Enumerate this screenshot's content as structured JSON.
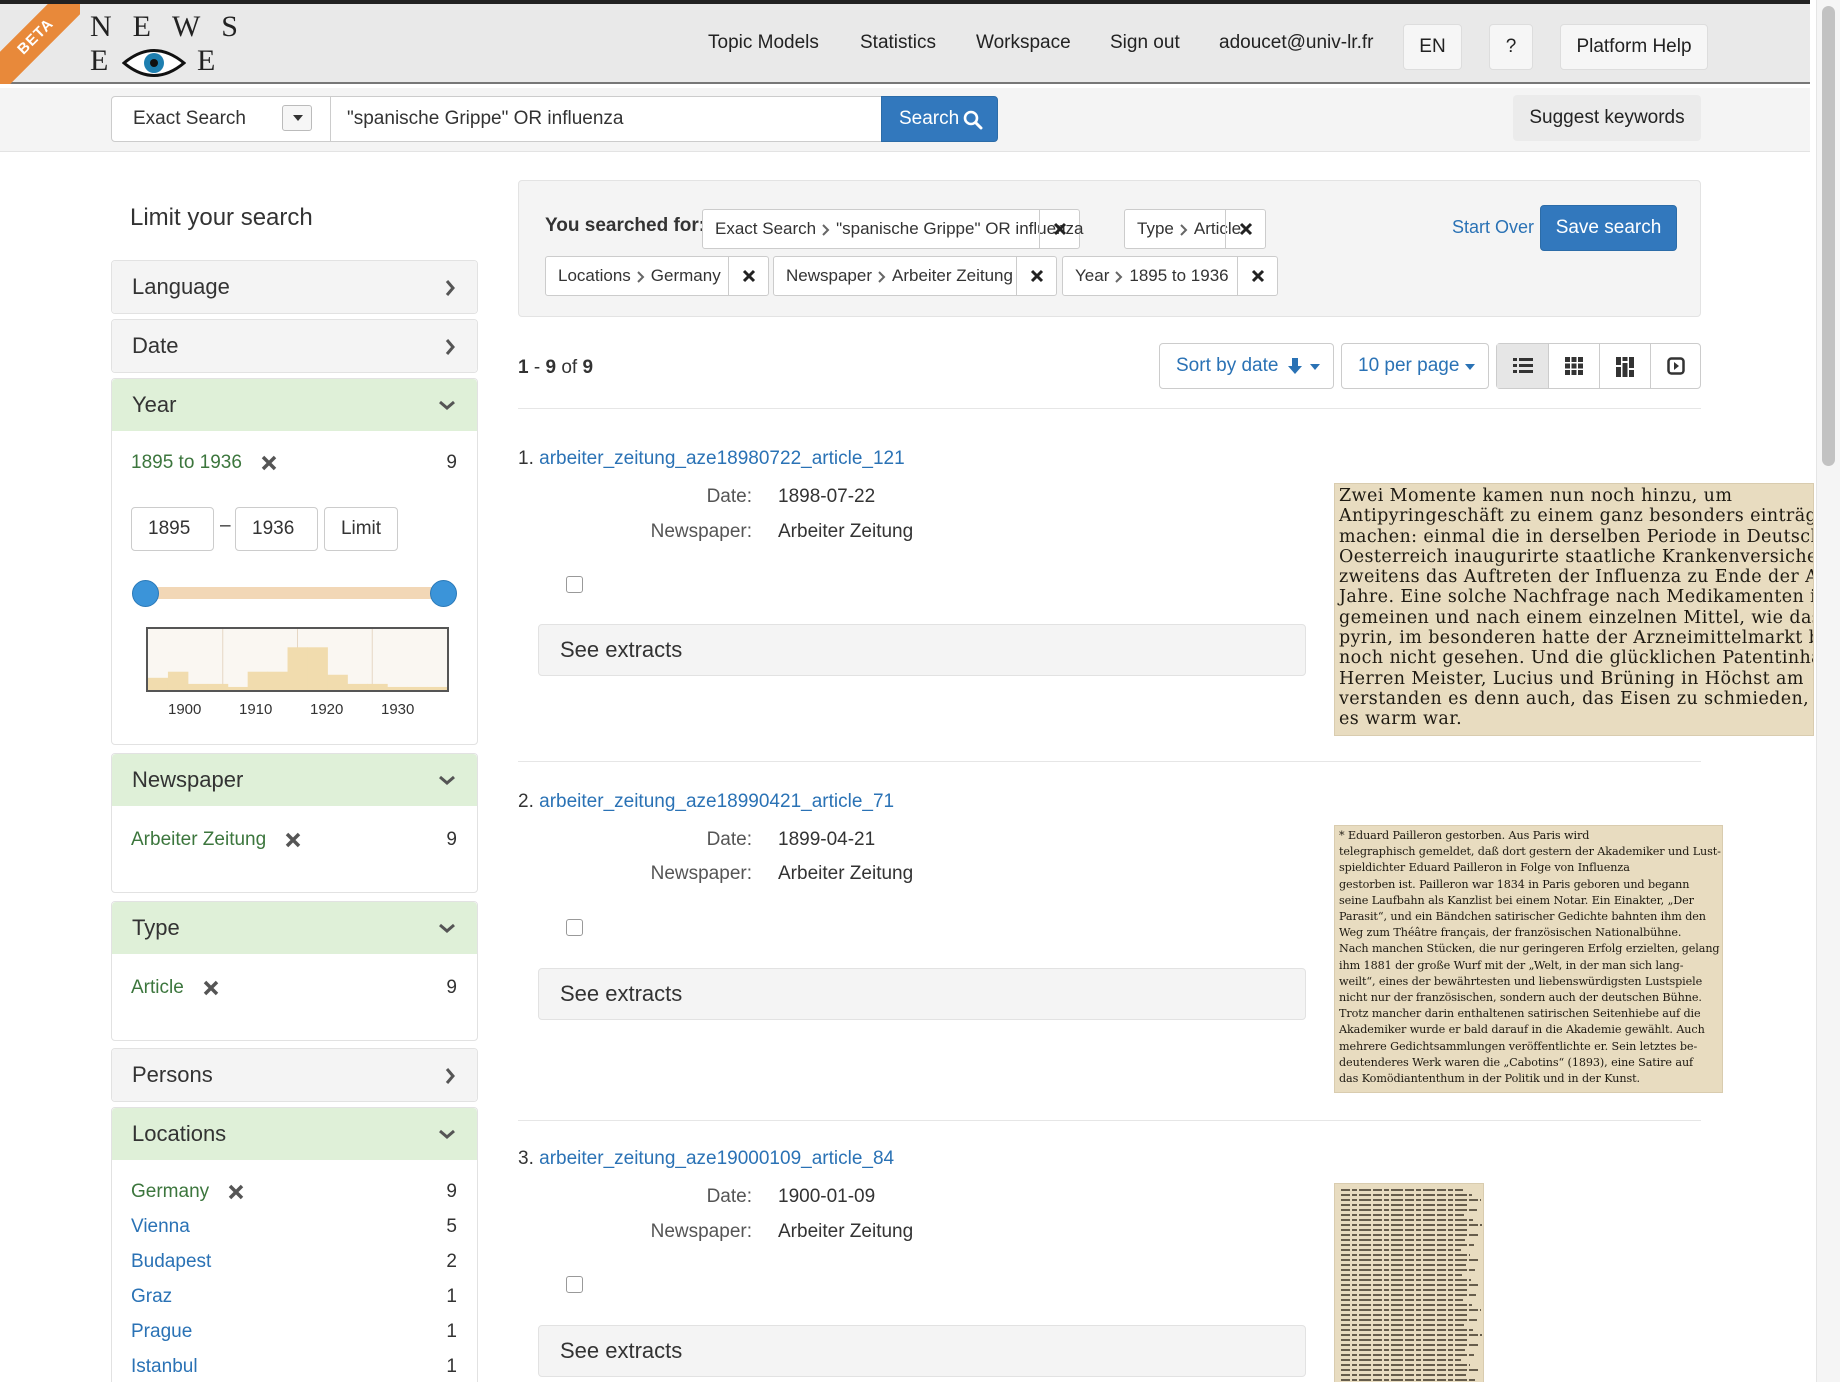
{
  "brand": {
    "beta": "BETA",
    "logo_top": "NEWS",
    "logo_left": "E",
    "logo_right": "E"
  },
  "nav": {
    "links": [
      "Topic Models",
      "Statistics",
      "Workspace",
      "Sign out",
      "adoucet@univ-lr.fr"
    ],
    "lang": "EN",
    "help_q": "?",
    "platform_help": "Platform Help"
  },
  "search": {
    "mode": "Exact Search",
    "query": "\"spanische Grippe\" OR influenza",
    "button": "Search",
    "suggest": "Suggest keywords"
  },
  "sidebar": {
    "title": "Limit your search",
    "facets": {
      "language": "Language",
      "date": "Date",
      "year": {
        "label": "Year",
        "selected": "1895 to 1936",
        "count": "9",
        "from": "1895",
        "to": "1936",
        "dash": "–",
        "limit": "Limit",
        "ticks": [
          "1900",
          "1910",
          "1920",
          "1930"
        ],
        "histogram": [
          0.2,
          0.3,
          0.1,
          0.1,
          0.05,
          0.3,
          0.3,
          0.7,
          0.7,
          0.25,
          0.1,
          0.1,
          0.05,
          0.05,
          0.05
        ]
      },
      "newspaper": {
        "label": "Newspaper",
        "value": "Arbeiter Zeitung",
        "count": "9"
      },
      "type": {
        "label": "Type",
        "value": "Article",
        "count": "9"
      },
      "persons": "Persons",
      "locations": {
        "label": "Locations",
        "items": [
          {
            "name": "Germany",
            "count": "9"
          },
          {
            "name": "Vienna",
            "count": "5"
          },
          {
            "name": "Budapest",
            "count": "2"
          },
          {
            "name": "Graz",
            "count": "1"
          },
          {
            "name": "Prague",
            "count": "1"
          },
          {
            "name": "Istanbul",
            "count": "1"
          }
        ]
      }
    }
  },
  "constraints": {
    "label": "You searched for:",
    "chips": [
      {
        "field": "Exact Search",
        "value": "\"spanische Grippe\" OR influenza"
      },
      {
        "field": "Type",
        "value": "Article"
      },
      {
        "field": "Locations",
        "value": "Germany"
      },
      {
        "field": "Newspaper",
        "value": "Arbeiter Zeitung"
      },
      {
        "field": "Year",
        "value": "1895 to 1936"
      }
    ],
    "start_over": "Start Over",
    "save": "Save search"
  },
  "results_bar": {
    "range_from": "1",
    "range_to": "9",
    "of": "of",
    "total": "9",
    "sort": "Sort by date",
    "per_page": "10 per page"
  },
  "results": [
    {
      "num": "1.",
      "title": "arbeiter_zeitung_aze18980722_article_121",
      "date_label": "Date:",
      "date": "1898-07-22",
      "paper_label": "Newspaper:",
      "paper": "Arbeiter Zeitung",
      "extracts": "See extracts",
      "scan_text": "Zwei Momente kamen nun noch hinzu, um\nAntipyringeschäft zu einem ganz besonders einträglid\nmachen: einmal die in derselben Periode in Deutschlan\nOesterreich inaugurirte staatliche Krankenversicherung,\nzweitens das Auftreten der Influenza zu Ende der Ach\nJahre. Eine solche Nachfrage nach Medikamenten i\ngemeinen und nach einem einzelnen Mittel, wie das\npyrin, im besonderen hatte der Arzneimittelmarkt bis\nnoch nicht gesehen. Und die glücklichen Patentinhaber\nHerren Meister, Lucius und Brüning in Höchst am\nverstanden es denn auch, das Eisen zu schmieden, so\nes warm war."
    },
    {
      "num": "2.",
      "title": "arbeiter_zeitung_aze18990421_article_71",
      "date_label": "Date:",
      "date": "1899-04-21",
      "paper_label": "Newspaper:",
      "paper": "Arbeiter Zeitung",
      "extracts": "See extracts",
      "scan_text": "* Eduard Pailleron gestorben. Aus Paris wird\ntelegraphisch gemeldet, daß dort gestern der Akademiker und Lust-\nspieldichter Eduard Pailleron in Folge von Influenza\ngestorben ist. Pailleron war 1834 in Paris geboren und begann\nseine Laufbahn als Kanzlist bei einem Notar. Ein Einakter, „Der\nParasit“, und ein Bändchen satirischer Gedichte bahnten ihm den\nWeg zum Théâtre français, der französischen Nationalbühne.\nNach manchen Stücken, die nur geringeren Erfolg erzielten, gelang\nihm 1881 der große Wurf mit der „Welt, in der man sich lang-\nweilt“, eines der bewährtesten und liebenswürdigsten Lustspiele\nnicht nur der französischen, sondern auch der deutschen Bühne.\nTrotz mancher darin enthaltenen satirischen Seitenhiebe auf die\nAkademiker wurde er bald darauf in die Akademie gewählt. Auch\nmehrere Gedichtsammlungen veröffentlichte er. Sein letztes be-\ndeutenderes Werk waren die „Cabotins“ (1893), eine Satire auf\ndas Komödiantenthum in der Politik und in der Kunst."
    },
    {
      "num": "3.",
      "title": "arbeiter_zeitung_aze19000109_article_84",
      "date_label": "Date:",
      "date": "1900-01-09",
      "paper_label": "Newspaper:",
      "paper": "Arbeiter Zeitung",
      "extracts": "See extracts",
      "scan_text": ""
    }
  ],
  "colors": {
    "nav_bg": "#e9e9e9",
    "primary": "#3278bd",
    "link": "#2a72b5",
    "facet_open": "#dff0d8",
    "facet_green_text": "#3c763d",
    "beta": "#e8893a",
    "slider_handle": "#3b94d9",
    "scan_paper": "#e8dcc0"
  },
  "icons": [
    "eye-logo-icon",
    "caret-down-icon",
    "search-icon",
    "chevron-right-icon",
    "chevron-down-icon",
    "remove-x-icon",
    "arrow-down-icon",
    "list-view-icon",
    "grid-view-icon",
    "masonry-view-icon",
    "slideshow-view-icon"
  ]
}
